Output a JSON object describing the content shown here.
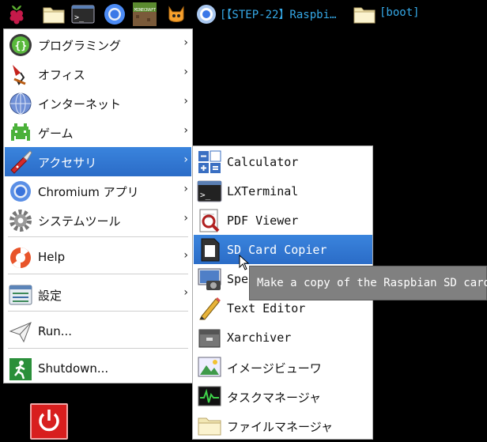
{
  "taskbar": {
    "icons": [
      "raspberry-icon",
      "folder-icon",
      "terminal-icon",
      "chromium-icon",
      "minecraft-icon",
      "scratch-icon",
      "chromium-window-icon",
      "folder-window-icon"
    ],
    "window_chromium_title": "[【STEP-22】Raspbi…",
    "window_folder_title": "[boot]"
  },
  "main_menu": {
    "items": [
      {
        "label": "プログラミング",
        "icon": "programming-icon",
        "has_submenu": true
      },
      {
        "label": "オフィス",
        "icon": "office-icon",
        "has_submenu": true
      },
      {
        "label": "インターネット",
        "icon": "internet-globe-icon",
        "has_submenu": true
      },
      {
        "label": "ゲーム",
        "icon": "game-invader-icon",
        "has_submenu": true
      },
      {
        "label": "アクセサリ",
        "icon": "accessories-knife-icon",
        "has_submenu": true,
        "active": true
      },
      {
        "label": "Chromium アプリ",
        "icon": "chromium-icon",
        "has_submenu": true
      },
      {
        "label": "システムツール",
        "icon": "system-gear-icon",
        "has_submenu": true
      },
      {
        "label": "Help",
        "icon": "help-lifebuoy-icon",
        "has_submenu": true
      },
      {
        "label": "設定",
        "icon": "settings-icon",
        "has_submenu": true
      },
      {
        "label": "Run...",
        "icon": "run-paper-plane-icon",
        "has_submenu": false
      },
      {
        "label": "Shutdown...",
        "icon": "shutdown-exit-icon",
        "has_submenu": false
      }
    ],
    "arrow": "›"
  },
  "accessories_menu": {
    "items": [
      {
        "label": "Calculator",
        "icon": "calculator-icon"
      },
      {
        "label": "LXTerminal",
        "icon": "terminal-icon"
      },
      {
        "label": "PDF Viewer",
        "icon": "pdf-viewer-icon"
      },
      {
        "label": "SD Card Copier",
        "icon": "sd-card-icon",
        "active": true
      },
      {
        "label": "Spec",
        "icon": "screenshot-camera-icon"
      },
      {
        "label": "Text Editor",
        "icon": "text-editor-pencil-icon"
      },
      {
        "label": "Xarchiver",
        "icon": "archive-icon"
      },
      {
        "label": "イメージビューワ",
        "icon": "image-viewer-icon"
      },
      {
        "label": "タスクマネージャ",
        "icon": "task-manager-icon"
      },
      {
        "label": "ファイルマネージャ",
        "icon": "file-manager-folder-icon"
      }
    ]
  },
  "tooltip": {
    "text": "Make a copy of the Raspbian SD card"
  },
  "colors": {
    "highlight": "#3479d6",
    "taskbar_text": "#35a8e6",
    "tooltip_bg": "#808080",
    "power_red": "#d81e1e"
  }
}
